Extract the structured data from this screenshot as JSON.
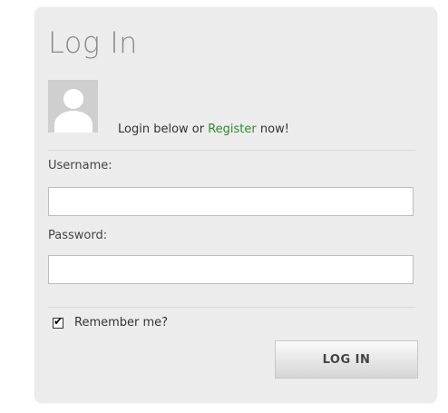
{
  "login": {
    "title": "Log In",
    "prompt_before": "Login below or ",
    "register_link": "Register",
    "prompt_after": " now!",
    "username_label": "Username:",
    "username_value": "",
    "password_label": "Password:",
    "password_value": "",
    "remember_label": "Remember me?",
    "remember_checked": true,
    "submit_label": "LOG IN"
  }
}
